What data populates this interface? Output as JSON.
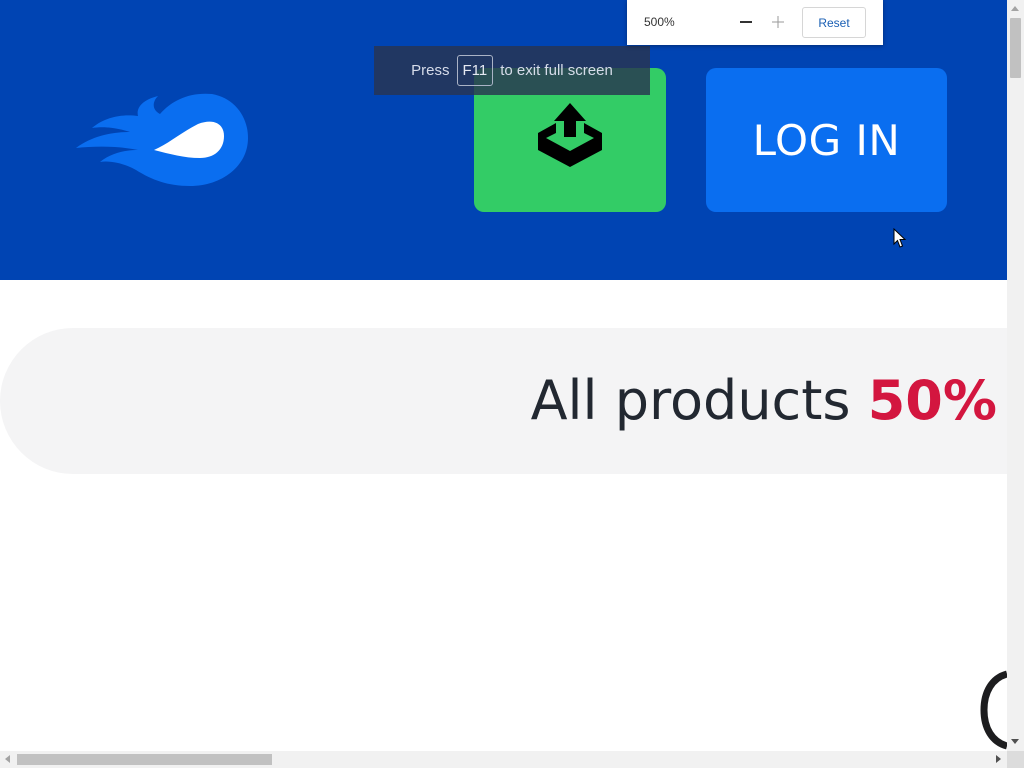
{
  "header": {
    "logo_icon": "flame-logo-icon",
    "upload_icon": "upload-box-icon",
    "login_label": "LOG IN",
    "colors": {
      "background": "#0044b3",
      "upload": "#33cc66",
      "login": "#0a6ef0"
    }
  },
  "fullscreen_toast": {
    "press": "Press",
    "key": "F11",
    "suffix": "to exit full screen"
  },
  "zoom_popup": {
    "level": "500%",
    "minus_icon": "minus-icon",
    "plus_icon": "plus-icon",
    "reset_label": "Reset"
  },
  "promo": {
    "text": "All products",
    "highlight": "50%",
    "highlight_color": "#d3163f"
  }
}
